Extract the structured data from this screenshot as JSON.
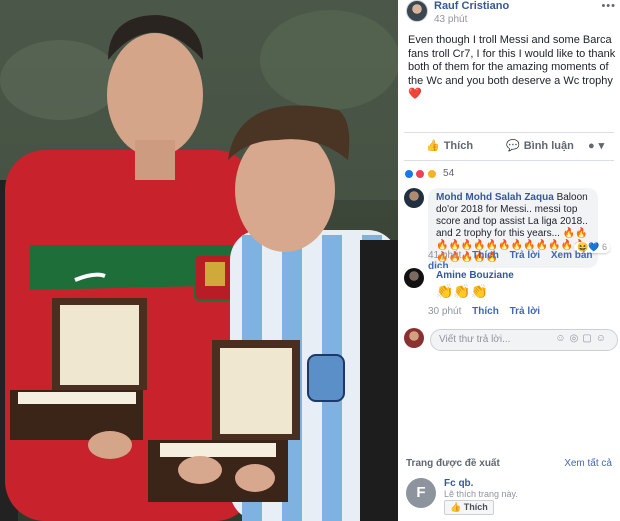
{
  "post": {
    "author": "Rauf Cristiano",
    "time": "43 phút",
    "more": "•••",
    "text": "Even though I troll Messi and some Barca fans troll Cr7, I for this I would like to thank both of them for the amazing moments of the Wc and you both deserve a Wc trophy ❤️"
  },
  "actions": {
    "like": "Thích",
    "comment": "Bình luận",
    "share": "▾"
  },
  "reactions": {
    "count": "54"
  },
  "comments": [
    {
      "name": "Mohd Mohd Salah Zaqua",
      "text": "Baloon do'or 2018 for Messi.. messi top score and top assist La liga 2018.. and 2 trophy for this years... 🔥🔥🔥🔥🔥🔥🔥🔥🔥🔥🔥🔥🔥🔥🔥🔥🔥🔥🔥",
      "time": "41 phút",
      "like": "Thích",
      "reply": "Trả lời",
      "extra": "Xem bản dịch",
      "react_count": "6"
    },
    {
      "name": "Amine Bouziane",
      "text": "👏👏👏",
      "time": "30 phút",
      "like": "Thích",
      "reply": "Trả lời"
    }
  ],
  "reply": {
    "placeholder": "Viết thư trả lời..."
  },
  "suggested": {
    "title": "Trang được đề xuất",
    "see_all": "Xem tất cả",
    "page": {
      "initial": "F",
      "name": "Fc qb.",
      "desc": "Lẽ thích trang này.",
      "like": "Thích"
    }
  },
  "colors": {
    "link": "#365899",
    "accent": "#4267b2",
    "muted": "#90949c"
  }
}
